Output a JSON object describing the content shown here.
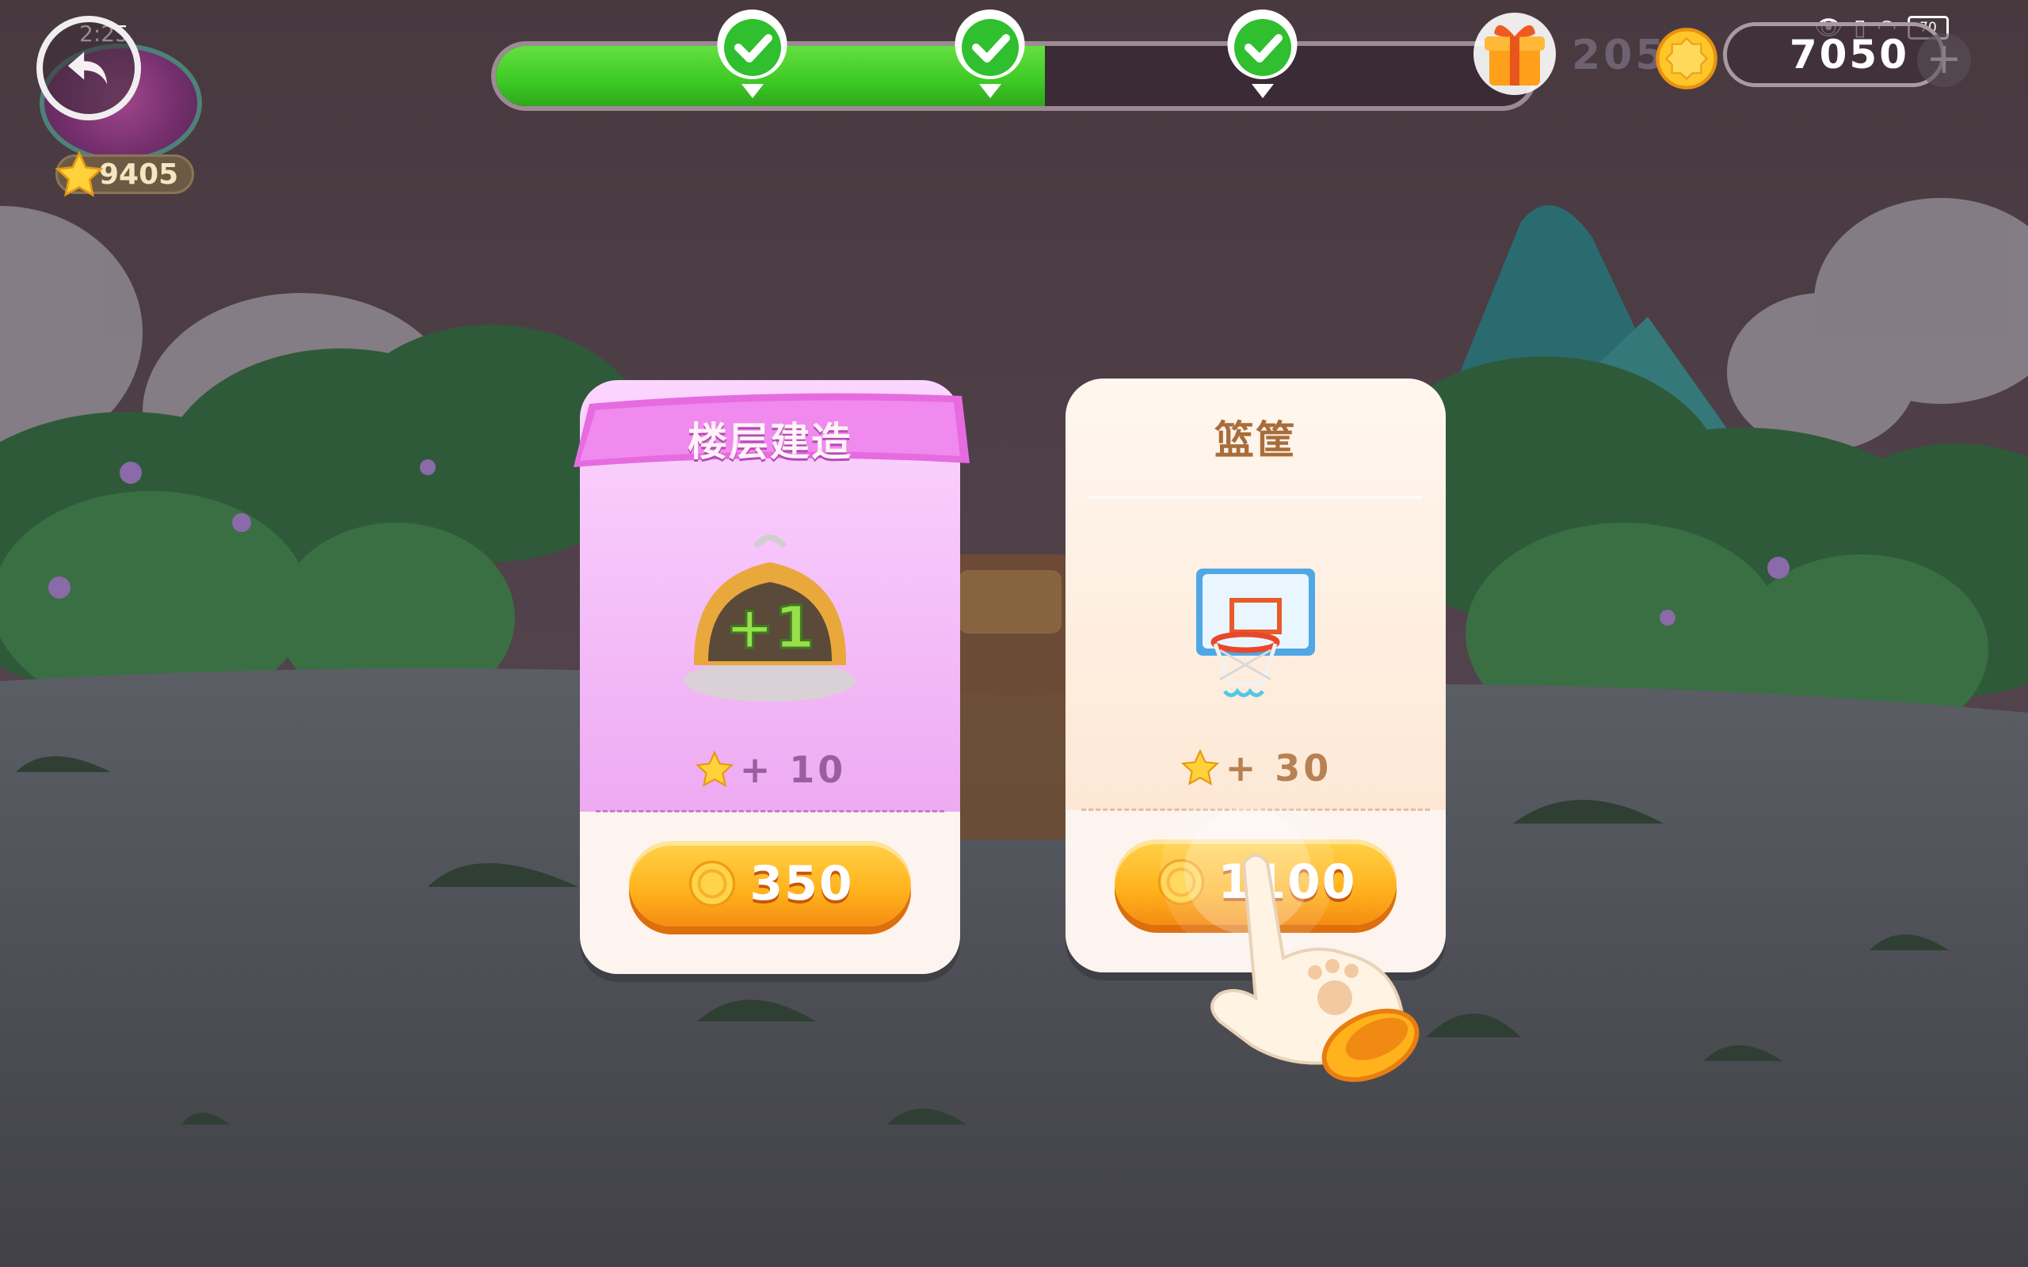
{
  "status_bar": {
    "time": "2:25",
    "battery": "70"
  },
  "player": {
    "stars": "9405"
  },
  "progress": {
    "fill_fraction": 0.53,
    "milestones_completed": 3
  },
  "currency": {
    "dim_value": "205",
    "coins": "7050"
  },
  "cards": [
    {
      "title": "楼层建造",
      "reward_label": "+ 10",
      "price": "350",
      "item_icon": "floor-dome-plus-one-icon"
    },
    {
      "title": "篮筐",
      "reward_label": "+ 30",
      "price": "1100",
      "item_icon": "basketball-hoop-icon"
    }
  ],
  "colors": {
    "progress_green": "#3dc924",
    "button_orange": "#ffb21c",
    "card1_pink": "#eeaaf2",
    "card2_cream": "#fdeedd"
  }
}
